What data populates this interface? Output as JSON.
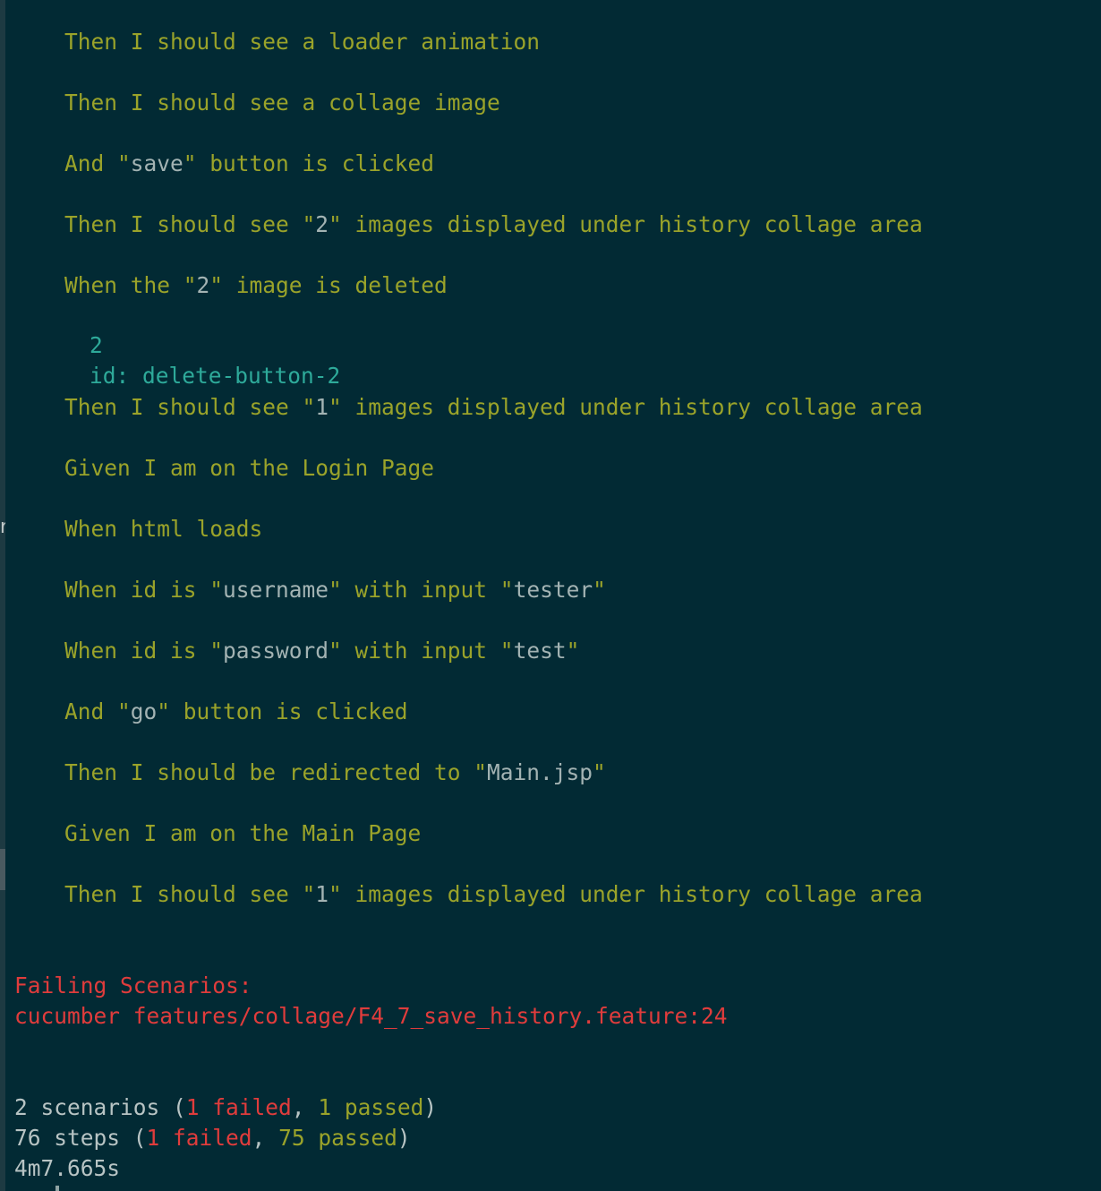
{
  "steps": [
    {
      "kw": "Then",
      "parts": [
        {
          "t": " I should see a loader animation"
        }
      ]
    },
    {
      "kw": "Then",
      "parts": [
        {
          "t": " I should see a collage image"
        }
      ]
    },
    {
      "kw": "And",
      "parts": [
        {
          "t": " \""
        },
        {
          "s": "save"
        },
        {
          "t": "\" button is clicked"
        }
      ]
    },
    {
      "kw": "Then",
      "parts": [
        {
          "t": " I should see \""
        },
        {
          "s": "2"
        },
        {
          "t": "\" images displayed under history collage area"
        }
      ]
    },
    {
      "kw": "When",
      "parts": [
        {
          "t": " the \""
        },
        {
          "s": "2"
        },
        {
          "t": "\" image is deleted"
        }
      ]
    },
    {
      "kw": "Then",
      "parts": [
        {
          "t": " I should see \""
        },
        {
          "s": "1"
        },
        {
          "t": "\" images displayed under history collage area"
        }
      ]
    },
    {
      "kw": "Given",
      "parts": [
        {
          "t": " I am on the Login Page"
        }
      ]
    },
    {
      "kw": "When",
      "parts": [
        {
          "t": " html loads"
        }
      ]
    },
    {
      "kw": "When",
      "parts": [
        {
          "t": " id is \""
        },
        {
          "s": "username"
        },
        {
          "t": "\" with input \""
        },
        {
          "s": "tester"
        },
        {
          "t": "\""
        }
      ]
    },
    {
      "kw": "When",
      "parts": [
        {
          "t": " id is \""
        },
        {
          "s": "password"
        },
        {
          "t": "\" with input \""
        },
        {
          "s": "test"
        },
        {
          "t": "\""
        }
      ]
    },
    {
      "kw": "And",
      "parts": [
        {
          "t": " \""
        },
        {
          "s": "go"
        },
        {
          "t": "\" button is clicked"
        }
      ]
    },
    {
      "kw": "Then",
      "parts": [
        {
          "t": " I should be redirected to \""
        },
        {
          "s": "Main.jsp"
        },
        {
          "t": "\""
        }
      ]
    },
    {
      "kw": "Given",
      "parts": [
        {
          "t": " I am on the Main Page"
        }
      ]
    },
    {
      "kw": "Then",
      "parts": [
        {
          "t": " I should see \""
        },
        {
          "s": "1"
        },
        {
          "t": "\" images displayed under history collage area"
        }
      ]
    }
  ],
  "doc_output": [
    "2",
    "id: delete-button-2"
  ],
  "failing": {
    "heading": "Failing Scenarios:",
    "command": "cucumber features/collage/F4_7_save_history.feature:24"
  },
  "summary": {
    "scenarios": {
      "count": "2 scenarios",
      "failed": "1 failed",
      "passed": "1 passed"
    },
    "steps": {
      "count": "76 steps",
      "failed": "1 failed",
      "passed": "75 passed"
    },
    "duration": "4m7.665s"
  },
  "colors": {
    "background": "#022a34",
    "step_text": "#9aa32a",
    "string_literal": "#a3b3b3",
    "doc_output": "#2eaa9a",
    "failed": "#e03c3c"
  }
}
